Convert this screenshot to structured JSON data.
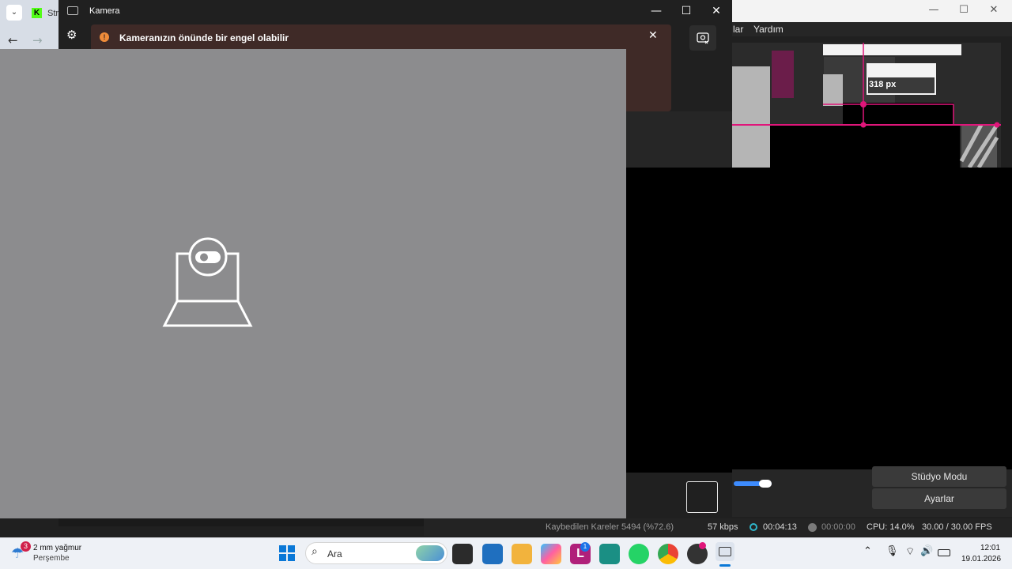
{
  "camera_app": {
    "window_title": "Kamera",
    "warning_text": "Kameranızın önünde bir engel olabilir"
  },
  "obs": {
    "menu": [
      "lar",
      "Yardım"
    ],
    "preview_label": "318 px",
    "buttons": {
      "studio_mode": "Stüdyo Modu",
      "settings": "Ayarlar"
    },
    "status": {
      "dropped_frames": "Kaybedilen Kareler 5494 (%72.6)",
      "bitrate": "57 kbps",
      "stream_time": "00:04:13",
      "record_time": "00:00:00",
      "cpu": "CPU: 14.0%",
      "fps": "30.00 / 30.00 FPS"
    }
  },
  "browser": {
    "tab_text": "Str"
  },
  "taskbar": {
    "weather": {
      "badge": "3",
      "line1": "2 mm yağmur",
      "line2": "Perşembe"
    },
    "search_label": "Ara",
    "letter_app_badge": "1",
    "clock": {
      "time": "12:01",
      "date": "19.01.2026"
    }
  },
  "colors": {
    "warning_accent": "#f08c3a",
    "obs_guides": "#e0167a",
    "camera_preview": "#8c8c8e"
  }
}
